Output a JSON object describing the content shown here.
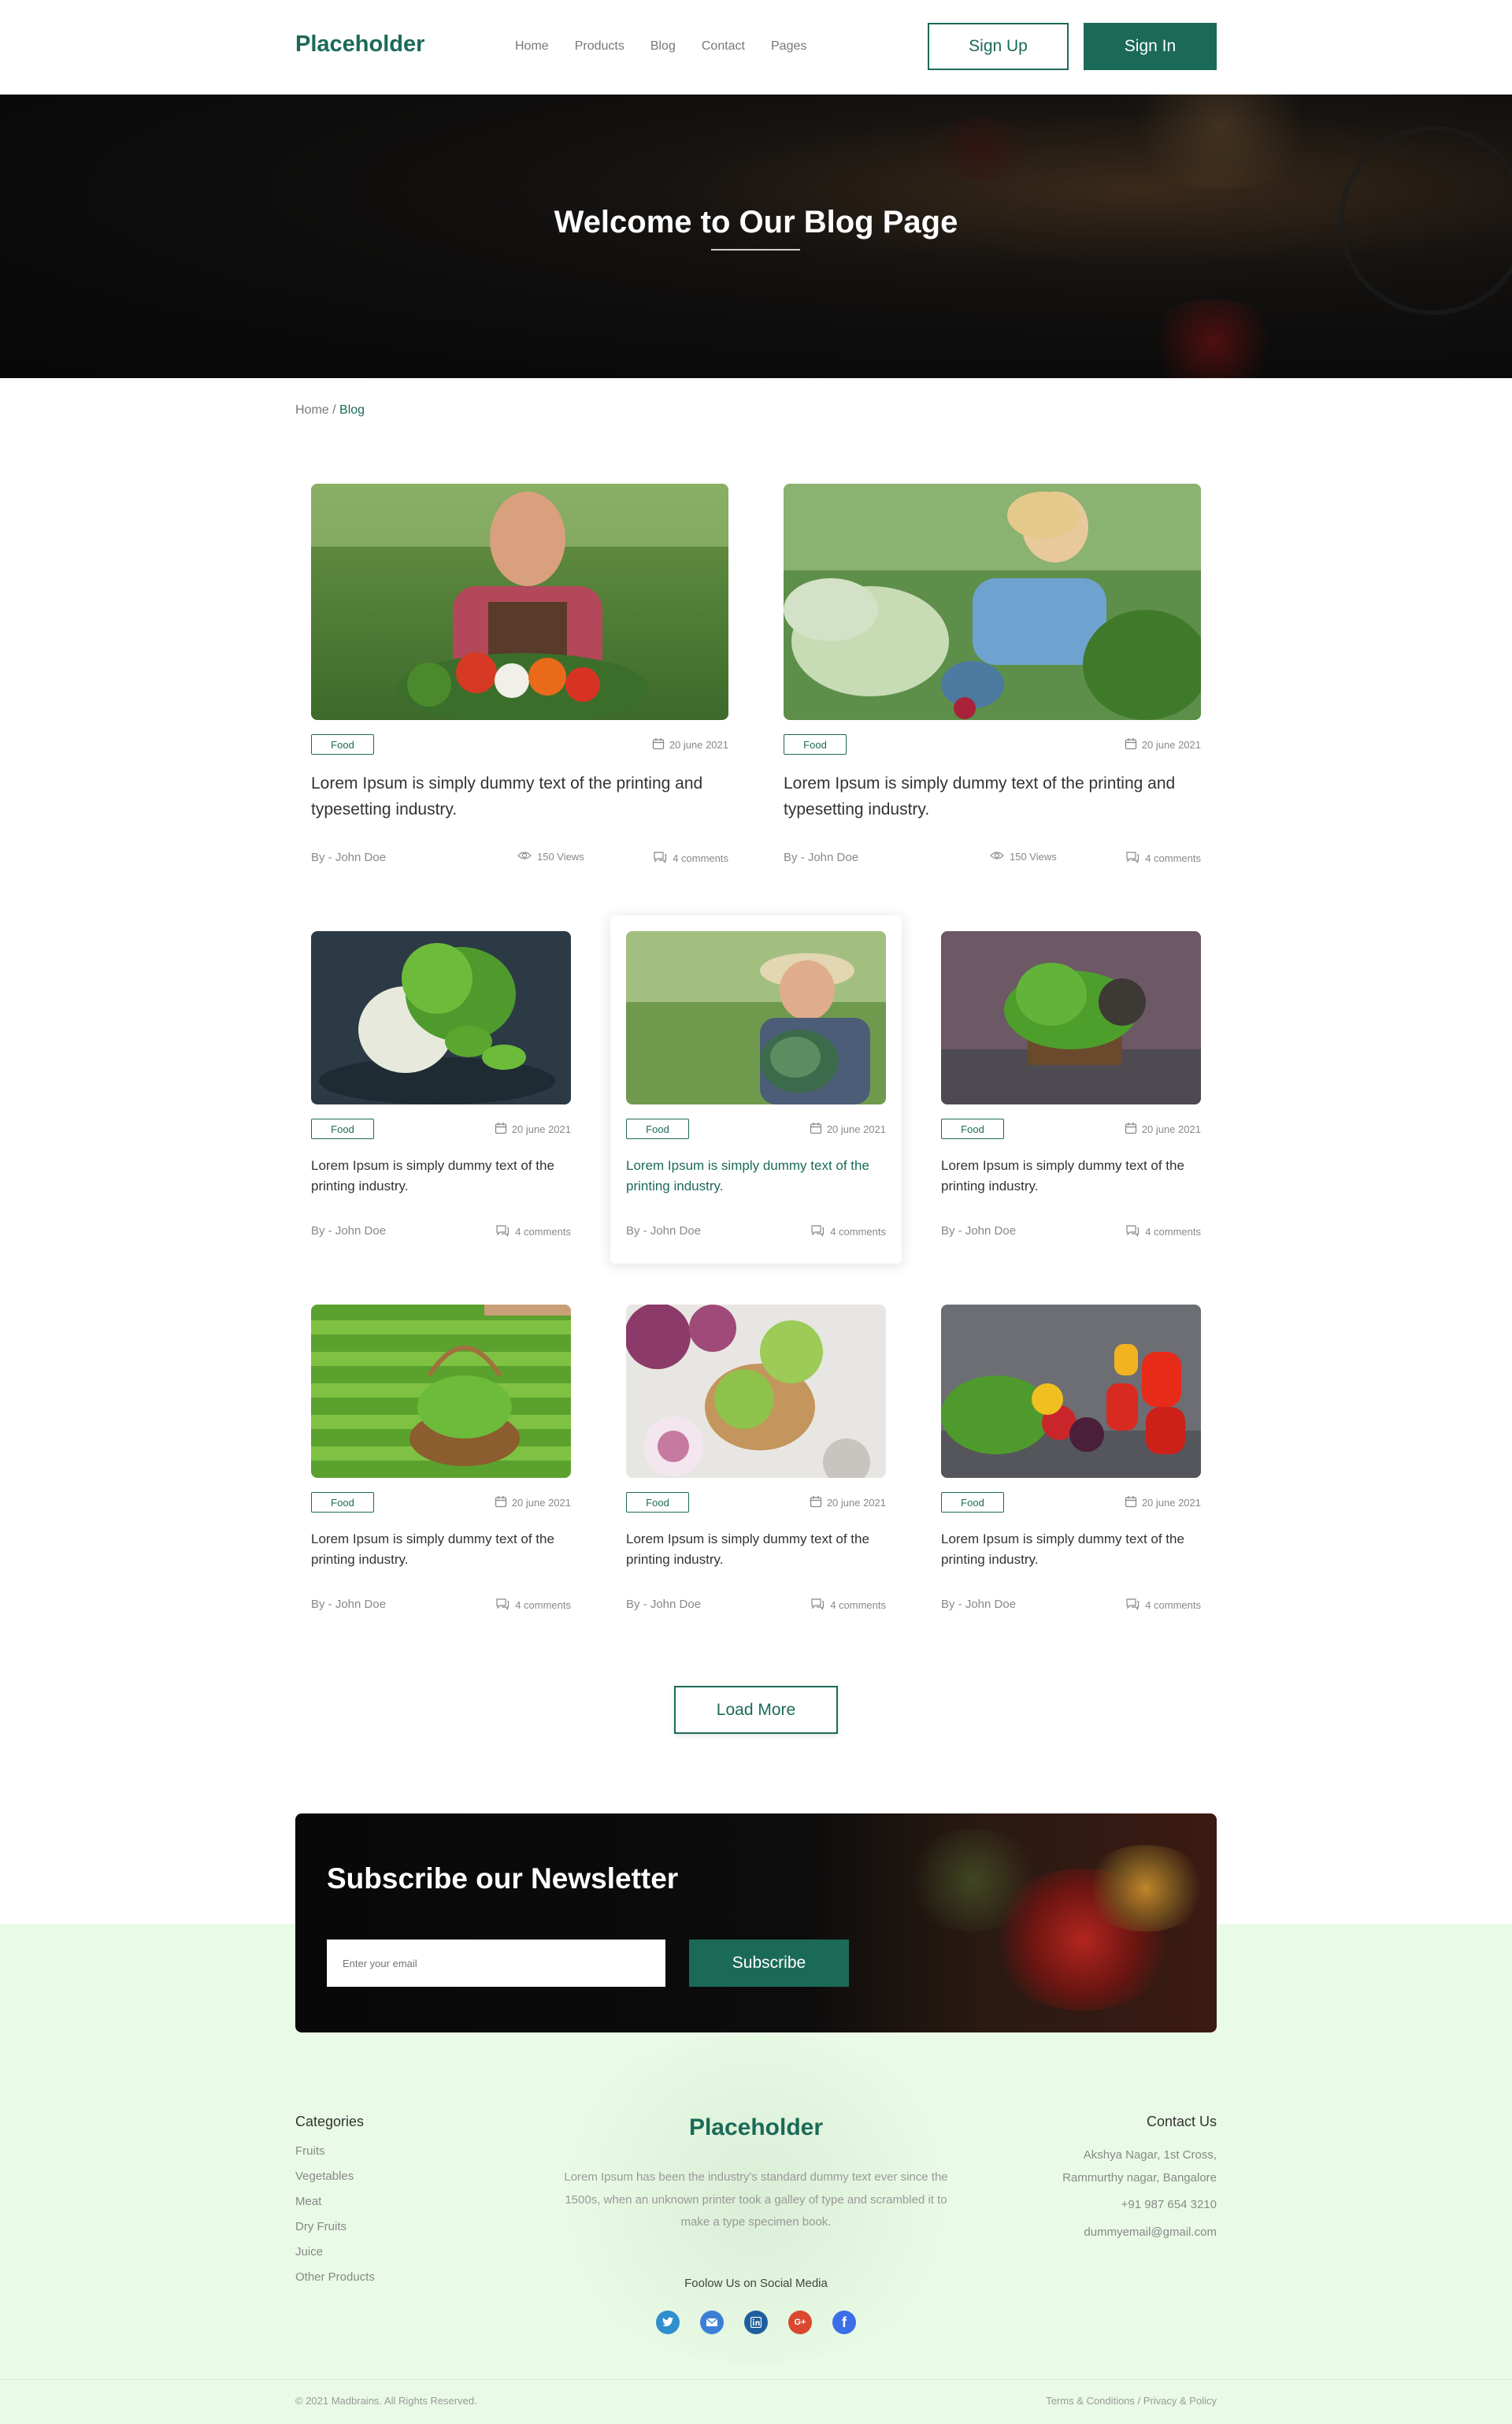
{
  "header": {
    "logo": "Placeholder",
    "nav": [
      "Home",
      "Products",
      "Blog",
      "Contact",
      "Pages"
    ],
    "sign_up": "Sign Up",
    "sign_in": "Sign In"
  },
  "hero": {
    "title": "Welcome to Our Blog Page"
  },
  "breadcrumb": {
    "home": "Home",
    "separator": "/",
    "current": "Blog"
  },
  "cards": [
    {
      "tag": "Food",
      "date": "20 june 2021",
      "title": "Lorem Ipsum is simply dummy text of the printing and typesetting industry.",
      "author": "By - John Doe",
      "views": "150 Views",
      "comments": "4 comments"
    },
    {
      "tag": "Food",
      "date": "20 june 2021",
      "title": "Lorem Ipsum is simply dummy text of the printing and typesetting industry.",
      "author": "By - John Doe",
      "views": "150 Views",
      "comments": "4 comments"
    },
    {
      "tag": "Food",
      "date": "20 june 2021",
      "title": "Lorem Ipsum is simply dummy text of the printing industry.",
      "author": "By - John Doe",
      "comments": "4 comments"
    },
    {
      "tag": "Food",
      "date": "20 june 2021",
      "title": "Lorem Ipsum is simply dummy text of the printing industry.",
      "author": "By - John Doe",
      "comments": "4 comments"
    },
    {
      "tag": "Food",
      "date": "20 june 2021",
      "title": "Lorem Ipsum is simply dummy text of the printing industry.",
      "author": "By - John Doe",
      "comments": "4 comments"
    },
    {
      "tag": "Food",
      "date": "20 june 2021",
      "title": "Lorem Ipsum is simply dummy text of the printing industry.",
      "author": "By - John Doe",
      "comments": "4 comments"
    },
    {
      "tag": "Food",
      "date": "20 june 2021",
      "title": "Lorem Ipsum is simply dummy text of the printing industry.",
      "author": "By - John Doe",
      "comments": "4 comments"
    },
    {
      "tag": "Food",
      "date": "20 june 2021",
      "title": "Lorem Ipsum is simply dummy text of the printing industry.",
      "author": "By - John Doe",
      "comments": "4 comments"
    }
  ],
  "load_more": "Load More",
  "newsletter": {
    "title": "Subscribe our Newsletter",
    "placeholder": "Enter your email",
    "button": "Subscribe"
  },
  "footer": {
    "categories_title": "Categories",
    "categories": [
      "Fruits",
      "Vegetables",
      "Meat",
      "Dry Fruits",
      "Juice",
      "Other Products"
    ],
    "brand": "Placeholder",
    "description": "Lorem Ipsum has been the industry's standard dummy text ever since the 1500s, when an unknown printer took a galley of type and scrambled it to make a type specimen book.",
    "follow": "Foolow Us on Social Media",
    "social": [
      "twitter-icon",
      "mail-icon",
      "linkedin-icon",
      "google-plus-icon",
      "facebook-icon"
    ],
    "contact_title": "Contact Us",
    "address_line1": "Akshya Nagar, 1st Cross,",
    "address_line2": "Rammurthy nagar, Bangalore",
    "phone": "+91 987 654 3210",
    "email": "dummyemail@gmail.com",
    "copyright": "© 2021 Madbrains. All Rights Reserved.",
    "terms": "Terms & Conditions",
    "links_sep": "/",
    "privacy": "Privacy & Policy"
  },
  "colors": {
    "brand": "#1b6a58",
    "footer_bg": "#e9fbe6"
  }
}
